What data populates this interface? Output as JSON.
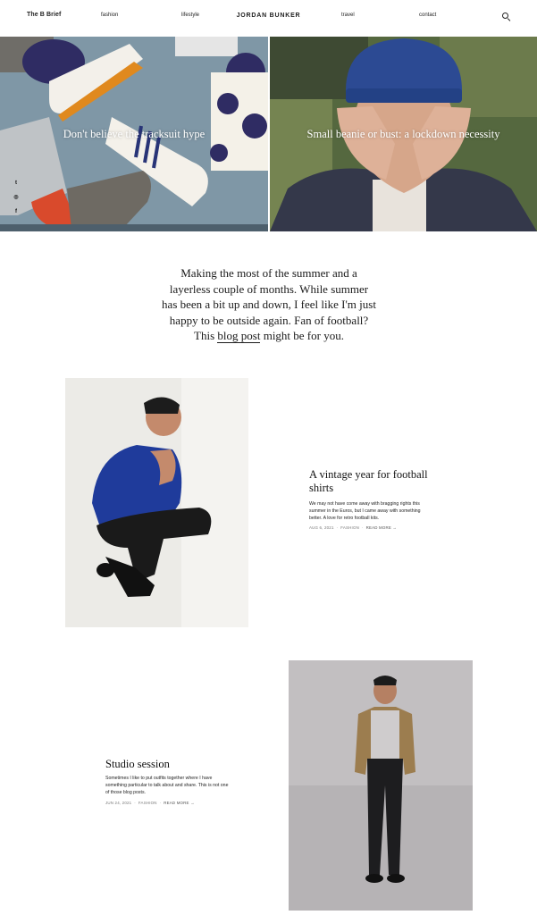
{
  "header": {
    "brand": "The B Brief",
    "logo": "JORDAN BUNKER",
    "nav": [
      "fashion",
      "lifestyle",
      "travel",
      "contact"
    ]
  },
  "hero": {
    "left_title": "Don't believe the tracksuit hype",
    "right_title": "Small beanie or bust: a lockdown necessity",
    "social": [
      "twitter-icon",
      "instagram-icon",
      "facebook-icon"
    ]
  },
  "intro": {
    "before_link": "Making the most of the summer and a layerless couple of months. While summer has been a bit up and down, I feel like I'm just happy to be outside again. Fan of football? This ",
    "link": "blog post",
    "after_link": " might be for you."
  },
  "posts": [
    {
      "title": "A vintage year for football shirts",
      "excerpt": "We may not have come away with bragging rights this summer in the Euros, but I came away with something better. A love for retro football kits.",
      "date": "AUG 6, 2021",
      "category": "FASHION",
      "read_more": "READ MORE →"
    },
    {
      "title": "Studio session",
      "excerpt": "Sometimes I like to put outfits together where I have something particular to talk about and share. This is not one of those blog posts.",
      "date": "JUN 24, 2021",
      "category": "FASHION",
      "read_more": "READ MORE →"
    }
  ]
}
